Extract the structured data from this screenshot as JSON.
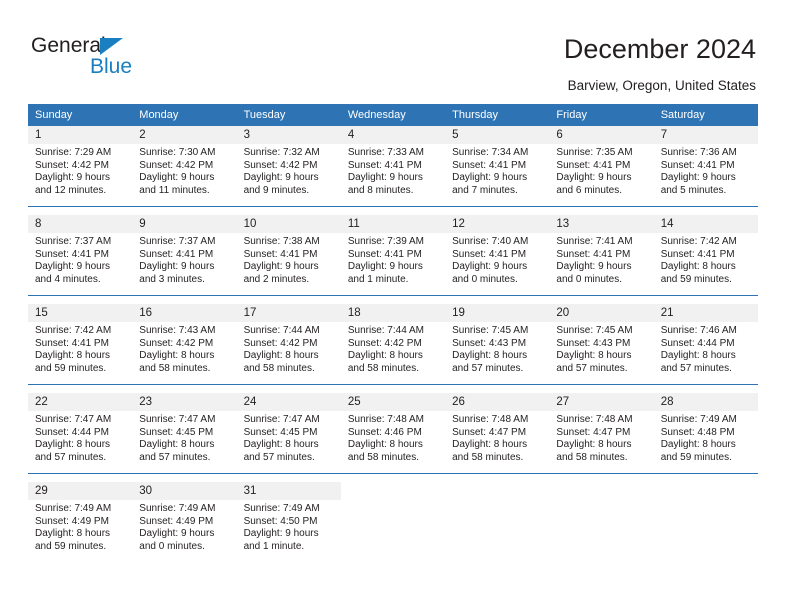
{
  "brand": {
    "name_top": "General",
    "name_bottom": "Blue",
    "accent_color": "#1a7fc1",
    "triangle_icon": "triangle-icon"
  },
  "header": {
    "title": "December 2024",
    "subtitle": "Barview, Oregon, United States"
  },
  "theme": {
    "header_bg": "#2e74b5",
    "daynum_bg": "#f1f1f1",
    "text": "#231f20",
    "separator": "#2e74b5"
  },
  "calendar": {
    "weekday_headers": [
      "Sunday",
      "Monday",
      "Tuesday",
      "Wednesday",
      "Thursday",
      "Friday",
      "Saturday"
    ],
    "weeks": [
      {
        "days": [
          {
            "num": "1",
            "sunrise": "Sunrise: 7:29 AM",
            "sunset": "Sunset: 4:42 PM",
            "daylight1": "Daylight: 9 hours",
            "daylight2": "and 12 minutes."
          },
          {
            "num": "2",
            "sunrise": "Sunrise: 7:30 AM",
            "sunset": "Sunset: 4:42 PM",
            "daylight1": "Daylight: 9 hours",
            "daylight2": "and 11 minutes."
          },
          {
            "num": "3",
            "sunrise": "Sunrise: 7:32 AM",
            "sunset": "Sunset: 4:42 PM",
            "daylight1": "Daylight: 9 hours",
            "daylight2": "and 9 minutes."
          },
          {
            "num": "4",
            "sunrise": "Sunrise: 7:33 AM",
            "sunset": "Sunset: 4:41 PM",
            "daylight1": "Daylight: 9 hours",
            "daylight2": "and 8 minutes."
          },
          {
            "num": "5",
            "sunrise": "Sunrise: 7:34 AM",
            "sunset": "Sunset: 4:41 PM",
            "daylight1": "Daylight: 9 hours",
            "daylight2": "and 7 minutes."
          },
          {
            "num": "6",
            "sunrise": "Sunrise: 7:35 AM",
            "sunset": "Sunset: 4:41 PM",
            "daylight1": "Daylight: 9 hours",
            "daylight2": "and 6 minutes."
          },
          {
            "num": "7",
            "sunrise": "Sunrise: 7:36 AM",
            "sunset": "Sunset: 4:41 PM",
            "daylight1": "Daylight: 9 hours",
            "daylight2": "and 5 minutes."
          }
        ]
      },
      {
        "days": [
          {
            "num": "8",
            "sunrise": "Sunrise: 7:37 AM",
            "sunset": "Sunset: 4:41 PM",
            "daylight1": "Daylight: 9 hours",
            "daylight2": "and 4 minutes."
          },
          {
            "num": "9",
            "sunrise": "Sunrise: 7:37 AM",
            "sunset": "Sunset: 4:41 PM",
            "daylight1": "Daylight: 9 hours",
            "daylight2": "and 3 minutes."
          },
          {
            "num": "10",
            "sunrise": "Sunrise: 7:38 AM",
            "sunset": "Sunset: 4:41 PM",
            "daylight1": "Daylight: 9 hours",
            "daylight2": "and 2 minutes."
          },
          {
            "num": "11",
            "sunrise": "Sunrise: 7:39 AM",
            "sunset": "Sunset: 4:41 PM",
            "daylight1": "Daylight: 9 hours",
            "daylight2": "and 1 minute."
          },
          {
            "num": "12",
            "sunrise": "Sunrise: 7:40 AM",
            "sunset": "Sunset: 4:41 PM",
            "daylight1": "Daylight: 9 hours",
            "daylight2": "and 0 minutes."
          },
          {
            "num": "13",
            "sunrise": "Sunrise: 7:41 AM",
            "sunset": "Sunset: 4:41 PM",
            "daylight1": "Daylight: 9 hours",
            "daylight2": "and 0 minutes."
          },
          {
            "num": "14",
            "sunrise": "Sunrise: 7:42 AM",
            "sunset": "Sunset: 4:41 PM",
            "daylight1": "Daylight: 8 hours",
            "daylight2": "and 59 minutes."
          }
        ]
      },
      {
        "days": [
          {
            "num": "15",
            "sunrise": "Sunrise: 7:42 AM",
            "sunset": "Sunset: 4:41 PM",
            "daylight1": "Daylight: 8 hours",
            "daylight2": "and 59 minutes."
          },
          {
            "num": "16",
            "sunrise": "Sunrise: 7:43 AM",
            "sunset": "Sunset: 4:42 PM",
            "daylight1": "Daylight: 8 hours",
            "daylight2": "and 58 minutes."
          },
          {
            "num": "17",
            "sunrise": "Sunrise: 7:44 AM",
            "sunset": "Sunset: 4:42 PM",
            "daylight1": "Daylight: 8 hours",
            "daylight2": "and 58 minutes."
          },
          {
            "num": "18",
            "sunrise": "Sunrise: 7:44 AM",
            "sunset": "Sunset: 4:42 PM",
            "daylight1": "Daylight: 8 hours",
            "daylight2": "and 58 minutes."
          },
          {
            "num": "19",
            "sunrise": "Sunrise: 7:45 AM",
            "sunset": "Sunset: 4:43 PM",
            "daylight1": "Daylight: 8 hours",
            "daylight2": "and 57 minutes."
          },
          {
            "num": "20",
            "sunrise": "Sunrise: 7:45 AM",
            "sunset": "Sunset: 4:43 PM",
            "daylight1": "Daylight: 8 hours",
            "daylight2": "and 57 minutes."
          },
          {
            "num": "21",
            "sunrise": "Sunrise: 7:46 AM",
            "sunset": "Sunset: 4:44 PM",
            "daylight1": "Daylight: 8 hours",
            "daylight2": "and 57 minutes."
          }
        ]
      },
      {
        "days": [
          {
            "num": "22",
            "sunrise": "Sunrise: 7:47 AM",
            "sunset": "Sunset: 4:44 PM",
            "daylight1": "Daylight: 8 hours",
            "daylight2": "and 57 minutes."
          },
          {
            "num": "23",
            "sunrise": "Sunrise: 7:47 AM",
            "sunset": "Sunset: 4:45 PM",
            "daylight1": "Daylight: 8 hours",
            "daylight2": "and 57 minutes."
          },
          {
            "num": "24",
            "sunrise": "Sunrise: 7:47 AM",
            "sunset": "Sunset: 4:45 PM",
            "daylight1": "Daylight: 8 hours",
            "daylight2": "and 57 minutes."
          },
          {
            "num": "25",
            "sunrise": "Sunrise: 7:48 AM",
            "sunset": "Sunset: 4:46 PM",
            "daylight1": "Daylight: 8 hours",
            "daylight2": "and 58 minutes."
          },
          {
            "num": "26",
            "sunrise": "Sunrise: 7:48 AM",
            "sunset": "Sunset: 4:47 PM",
            "daylight1": "Daylight: 8 hours",
            "daylight2": "and 58 minutes."
          },
          {
            "num": "27",
            "sunrise": "Sunrise: 7:48 AM",
            "sunset": "Sunset: 4:47 PM",
            "daylight1": "Daylight: 8 hours",
            "daylight2": "and 58 minutes."
          },
          {
            "num": "28",
            "sunrise": "Sunrise: 7:49 AM",
            "sunset": "Sunset: 4:48 PM",
            "daylight1": "Daylight: 8 hours",
            "daylight2": "and 59 minutes."
          }
        ]
      },
      {
        "days": [
          {
            "num": "29",
            "sunrise": "Sunrise: 7:49 AM",
            "sunset": "Sunset: 4:49 PM",
            "daylight1": "Daylight: 8 hours",
            "daylight2": "and 59 minutes."
          },
          {
            "num": "30",
            "sunrise": "Sunrise: 7:49 AM",
            "sunset": "Sunset: 4:49 PM",
            "daylight1": "Daylight: 9 hours",
            "daylight2": "and 0 minutes."
          },
          {
            "num": "31",
            "sunrise": "Sunrise: 7:49 AM",
            "sunset": "Sunset: 4:50 PM",
            "daylight1": "Daylight: 9 hours",
            "daylight2": "and 1 minute."
          },
          {
            "num": "",
            "sunrise": "",
            "sunset": "",
            "daylight1": "",
            "daylight2": ""
          },
          {
            "num": "",
            "sunrise": "",
            "sunset": "",
            "daylight1": "",
            "daylight2": ""
          },
          {
            "num": "",
            "sunrise": "",
            "sunset": "",
            "daylight1": "",
            "daylight2": ""
          },
          {
            "num": "",
            "sunrise": "",
            "sunset": "",
            "daylight1": "",
            "daylight2": ""
          }
        ]
      }
    ]
  }
}
